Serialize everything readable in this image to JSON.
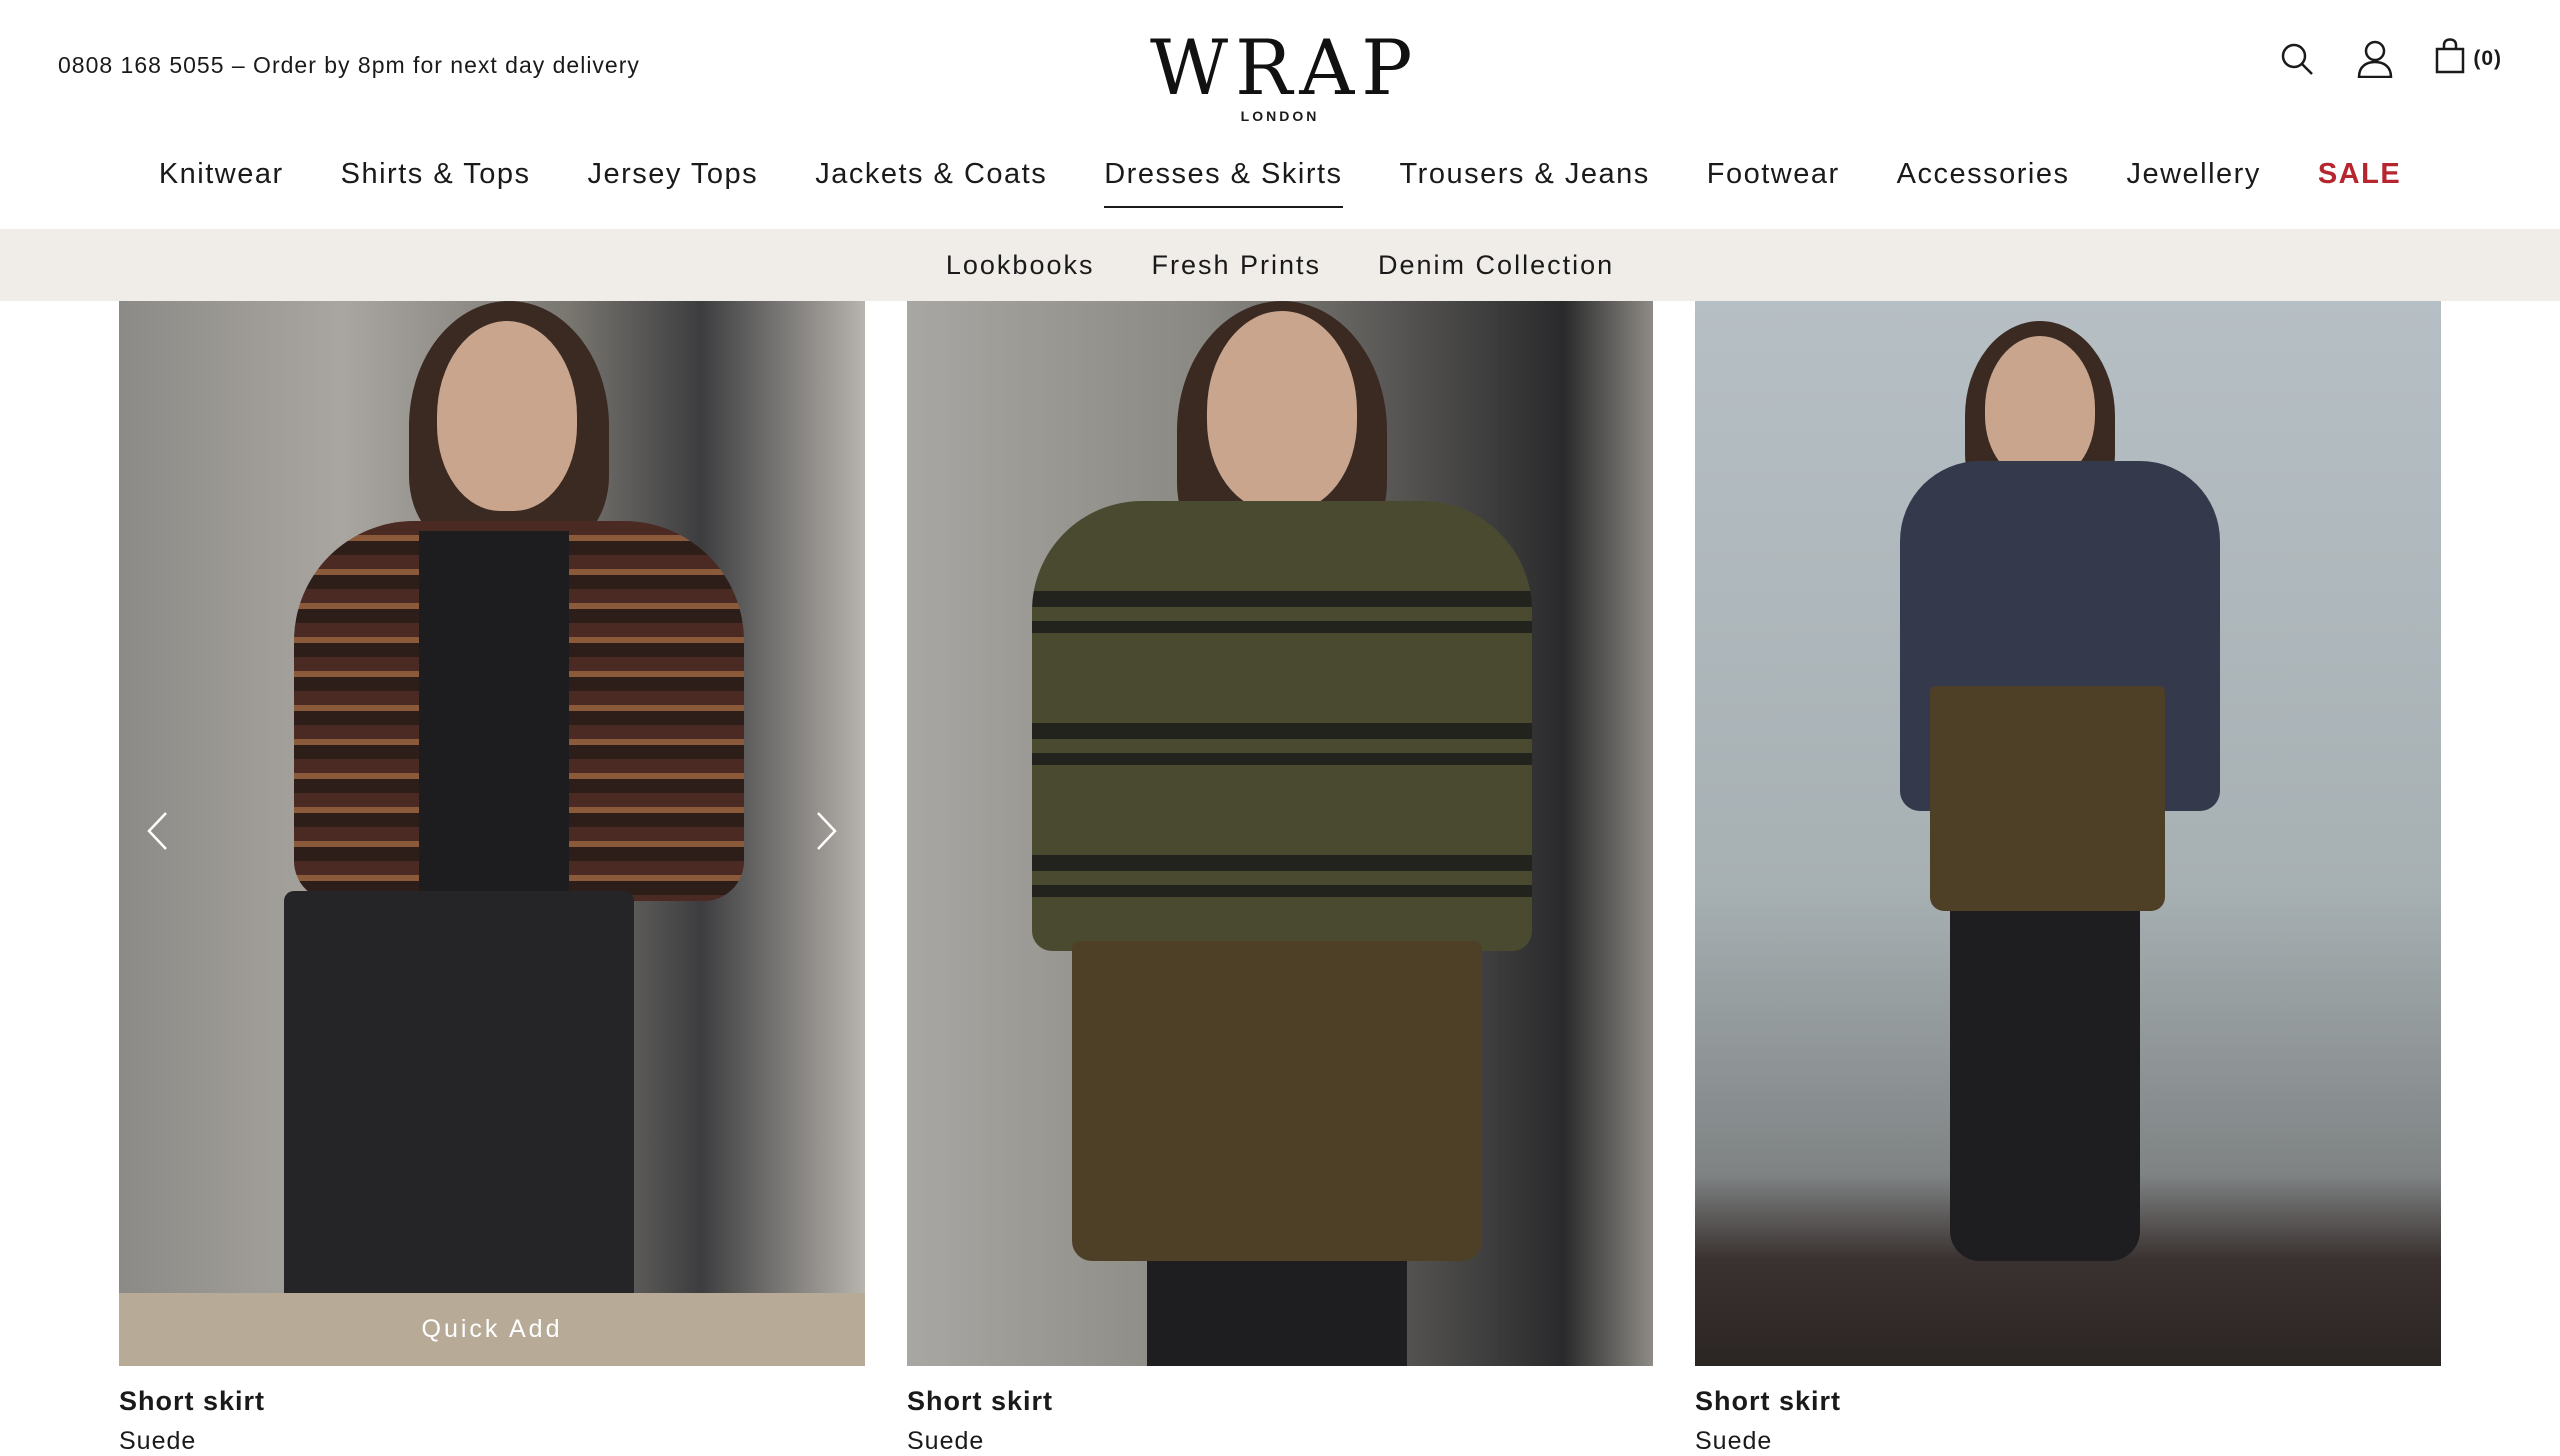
{
  "header": {
    "promo": "0808 168 5055 – Order by 8pm for next day delivery",
    "logo_main": "WRAP",
    "logo_sub": "LONDON",
    "cart_count": "(0)",
    "icons": [
      "search-icon",
      "account-icon",
      "bag-icon"
    ]
  },
  "nav": {
    "items": [
      "Knitwear",
      "Shirts & Tops",
      "Jersey Tops",
      "Jackets & Coats",
      "Dresses & Skirts",
      "Trousers & Jeans",
      "Footwear",
      "Accessories",
      "Jewellery",
      "SALE"
    ],
    "active": "Dresses & Skirts",
    "sale_color": "#b5262f"
  },
  "subnav": {
    "items": [
      "Lookbooks",
      "Fresh Prints",
      "Denim Collection"
    ]
  },
  "products": [
    {
      "name": "Short skirt",
      "material": "Suede",
      "quick_add": "Quick Add"
    },
    {
      "name": "Short skirt",
      "material": "Suede"
    },
    {
      "name": "Short skirt",
      "material": "Suede"
    }
  ],
  "colors": {
    "subnav_bg": "#f0ede9",
    "quick_add_bg": "#b7ab98",
    "text": "#1a1a1a"
  }
}
